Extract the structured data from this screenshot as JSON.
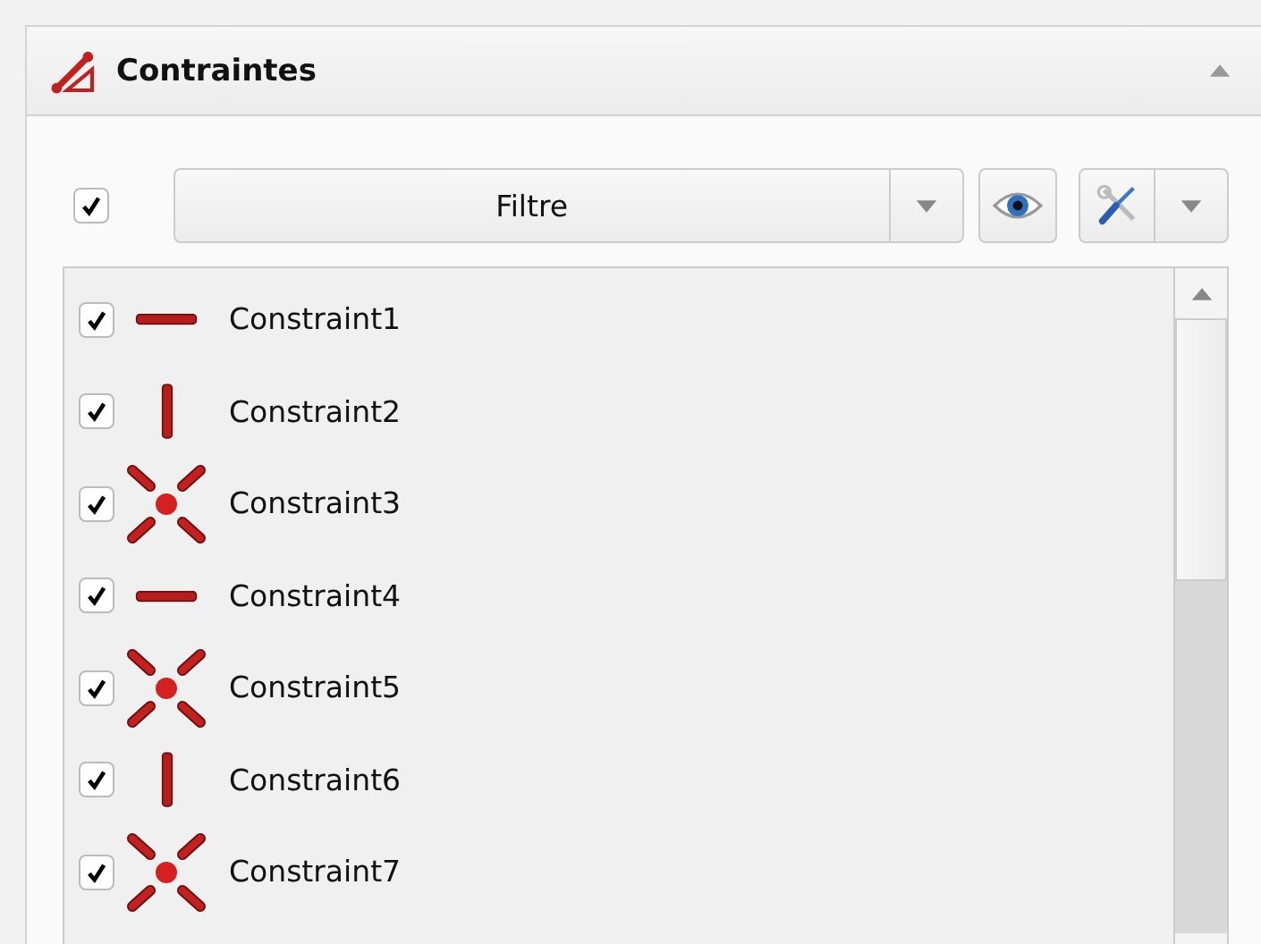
{
  "panel": {
    "title": "Contraintes",
    "expanded": true
  },
  "toolbar": {
    "show_all_checked": true,
    "filter": {
      "value": "Filtre"
    }
  },
  "constraints": [
    {
      "label": "Constraint1",
      "kind": "horizontal",
      "checked": true
    },
    {
      "label": "Constraint2",
      "kind": "vertical",
      "checked": true
    },
    {
      "label": "Constraint3",
      "kind": "coincident",
      "checked": true
    },
    {
      "label": "Constraint4",
      "kind": "horizontal",
      "checked": true
    },
    {
      "label": "Constraint5",
      "kind": "coincident",
      "checked": true
    },
    {
      "label": "Constraint6",
      "kind": "vertical",
      "checked": true
    },
    {
      "label": "Constraint7",
      "kind": "coincident",
      "checked": true
    }
  ]
}
